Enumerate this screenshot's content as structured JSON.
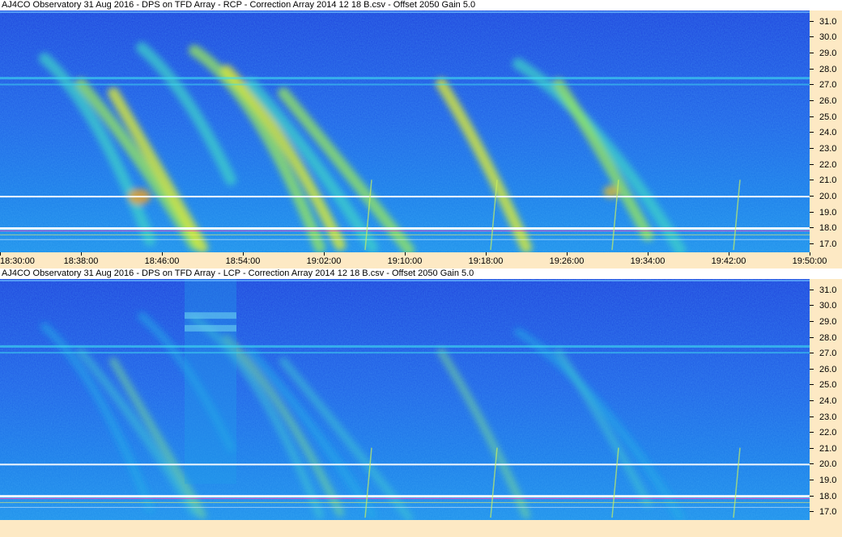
{
  "chart_data": [
    {
      "type": "heatmap",
      "title": "AJ4CO Observatory 31 Aug 2016  -  DPS on TFD Array  -  RCP  -  Correction Array 2014 12 18 B.csv  -  Offset 2050  Gain 5.0",
      "x_ticks": [
        "18:30:00",
        "18:38:00",
        "18:46:00",
        "18:54:00",
        "19:02:00",
        "19:10:00",
        "19:18:00",
        "19:26:00",
        "19:34:00",
        "19:42:00",
        "19:50:00"
      ],
      "y_ticks": [
        "31.0",
        "30.0",
        "29.0",
        "28.0",
        "27.0",
        "26.0",
        "25.0",
        "24.0",
        "23.0",
        "22.0",
        "21.0",
        "20.0",
        "19.0",
        "18.0",
        "17.0"
      ],
      "ylim": [
        16.5,
        31.7
      ],
      "colors": {
        "low": "#1a3bd8",
        "mid": "#19a0f0",
        "high": "#e8f020",
        "peak": "#f0a020"
      }
    },
    {
      "type": "heatmap",
      "title": "AJ4CO Observatory 31 Aug 2016  -  DPS on TFD Array  -  LCP  -  Correction Array 2014 12 18 B.csv  -  Offset 2050  Gain 5.0",
      "x_ticks": [],
      "y_ticks": [
        "31.0",
        "30.0",
        "29.0",
        "28.0",
        "27.0",
        "26.0",
        "25.0",
        "24.0",
        "23.0",
        "22.0",
        "21.0",
        "20.0",
        "19.0",
        "18.0",
        "17.0"
      ],
      "ylim": [
        16.5,
        31.7
      ],
      "colors": {
        "low": "#1a3bd8",
        "mid": "#19a0f0",
        "high": "#e8f020",
        "peak": "#f0a020"
      }
    }
  ]
}
